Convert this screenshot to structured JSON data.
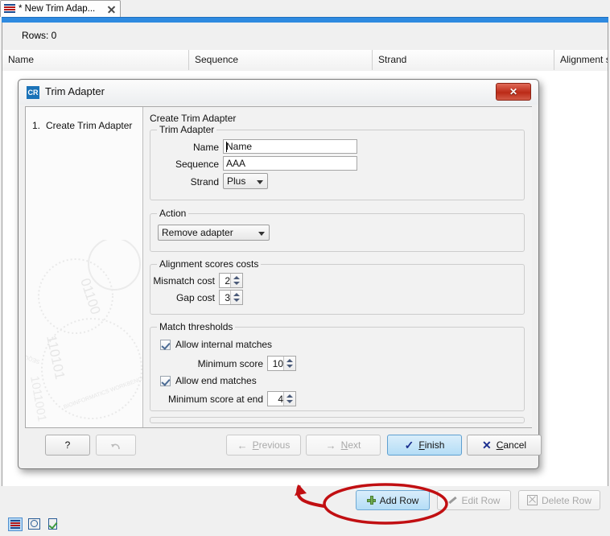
{
  "window": {
    "tab": {
      "label": "* New Trim Adap...",
      "icon": "table-stripes-icon",
      "close_icon": "close-icon"
    },
    "rows_status": "Rows: 0",
    "table": {
      "columns": [
        "Name",
        "Sequence",
        "Strand",
        "Alignment scor"
      ],
      "rows": []
    },
    "toolbar": {
      "add_row": "Add Row",
      "edit_row": "Edit Row",
      "delete_row": "Delete Row"
    },
    "status_icons": [
      "table-view-icon",
      "history-icon",
      "element-info-icon"
    ]
  },
  "dialog": {
    "icon_text": "CR",
    "title": "Trim Adapter",
    "close": "✕",
    "steps": [
      {
        "number": "1.",
        "label": "Create Trim Adapter"
      }
    ],
    "pane_title": "Create Trim Adapter",
    "groups": {
      "trim_adapter": {
        "legend": "Trim Adapter",
        "name_label": "Name",
        "name_value": "Name",
        "sequence_label": "Sequence",
        "sequence_value": "AAA",
        "strand_label": "Strand",
        "strand_value": "Plus"
      },
      "action": {
        "legend": "Action",
        "value": "Remove adapter"
      },
      "alignment": {
        "legend": "Alignment scores costs",
        "mismatch_label": "Mismatch cost",
        "mismatch_value": "2",
        "gap_label": "Gap cost",
        "gap_value": "3"
      },
      "match": {
        "legend": "Match thresholds",
        "internal_label": "Allow internal matches",
        "min_score_label": "Minimum score",
        "min_score_value": "10",
        "end_label": "Allow end matches",
        "min_score_end_label": "Minimum score at end",
        "min_score_end_value": "4"
      }
    },
    "footer": {
      "help": "?",
      "reset": "reset-icon",
      "previous": "Previous",
      "next": "Next",
      "finish": "Finish",
      "cancel": "Cancel"
    }
  },
  "colors": {
    "accent_blue": "#2e8ae0",
    "annotation_red": "#c10f12",
    "close_red": "#bb2a17",
    "selected_button": "#b4ddf6"
  }
}
